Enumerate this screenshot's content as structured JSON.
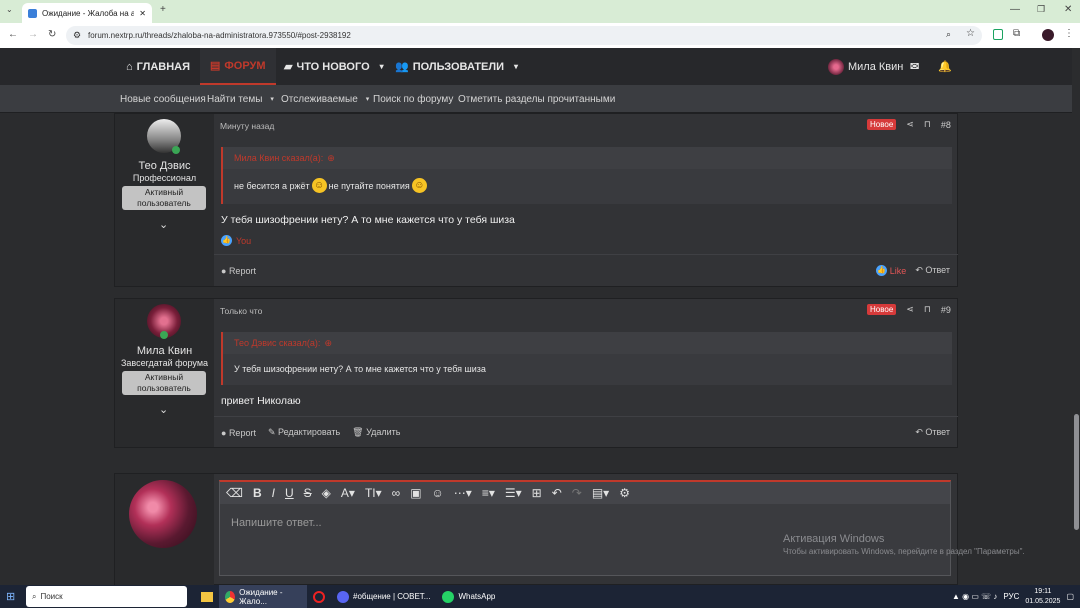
{
  "browser": {
    "tab_title": "Ожидание - Жалоба на адми",
    "url": "forum.nextrp.ru/threads/zhaloba-na-administratora.973550/#post-2938192"
  },
  "nav": {
    "home": "ГЛАВНАЯ",
    "forum": "ФОРУМ",
    "whats_new": "ЧТО НОВОГО",
    "users": "ПОЛЬЗОВАТЕЛИ",
    "username": "Мила Квин"
  },
  "subnav": [
    "Новые сообщения",
    "Найти темы",
    "Отслеживаемые",
    "Поиск по форуму",
    "Отметить разделы прочитанными"
  ],
  "posts": [
    {
      "author": "Тео Дэвис",
      "title": "Профессионал",
      "badge": "Активный пользователь",
      "time": "Минуту назад",
      "new_label": "Новое",
      "number": "#8",
      "quote_author": "Мила Квин сказал(а):",
      "quote_text_1": "не бесится а ржёт",
      "quote_text_2": "не путайте понятия",
      "message": "У тебя шизофрении нету? А то мне кажется что у тебя шиза",
      "reaction": "You",
      "report": "Report",
      "like": "Like",
      "reply": "Ответ"
    },
    {
      "author": "Мила Квин",
      "title": "Завсегдатай форума",
      "badge": "Активный пользователь",
      "time": "Только что",
      "new_label": "Новое",
      "number": "#9",
      "quote_author": "Тео Дэвис сказал(а):",
      "quote_text": "У тебя шизофрении нету? А то мне кажется что у тебя шиза",
      "message": "привет Николаю",
      "report": "Report",
      "edit": "Редактировать",
      "delete": "Удалить",
      "reply": "Ответ"
    }
  ],
  "editor": {
    "placeholder": "Напишите ответ..."
  },
  "watermark": {
    "title": "Активация Windows",
    "subtitle": "Чтобы активировать Windows, перейдите в раздел \"Параметры\"."
  },
  "taskbar": {
    "search": "Поиск",
    "chrome": "Ожидание - Жало...",
    "discord": "#общение | СОВЕТ...",
    "whatsapp": "WhatsApp",
    "lang": "РУС",
    "time": "19:11",
    "date": "01.05.2025"
  },
  "colors": {
    "accent": "#c0392b",
    "new_badge": "#d63a3a",
    "like": "#4aa3ff",
    "taskbar": "#1c2435"
  }
}
